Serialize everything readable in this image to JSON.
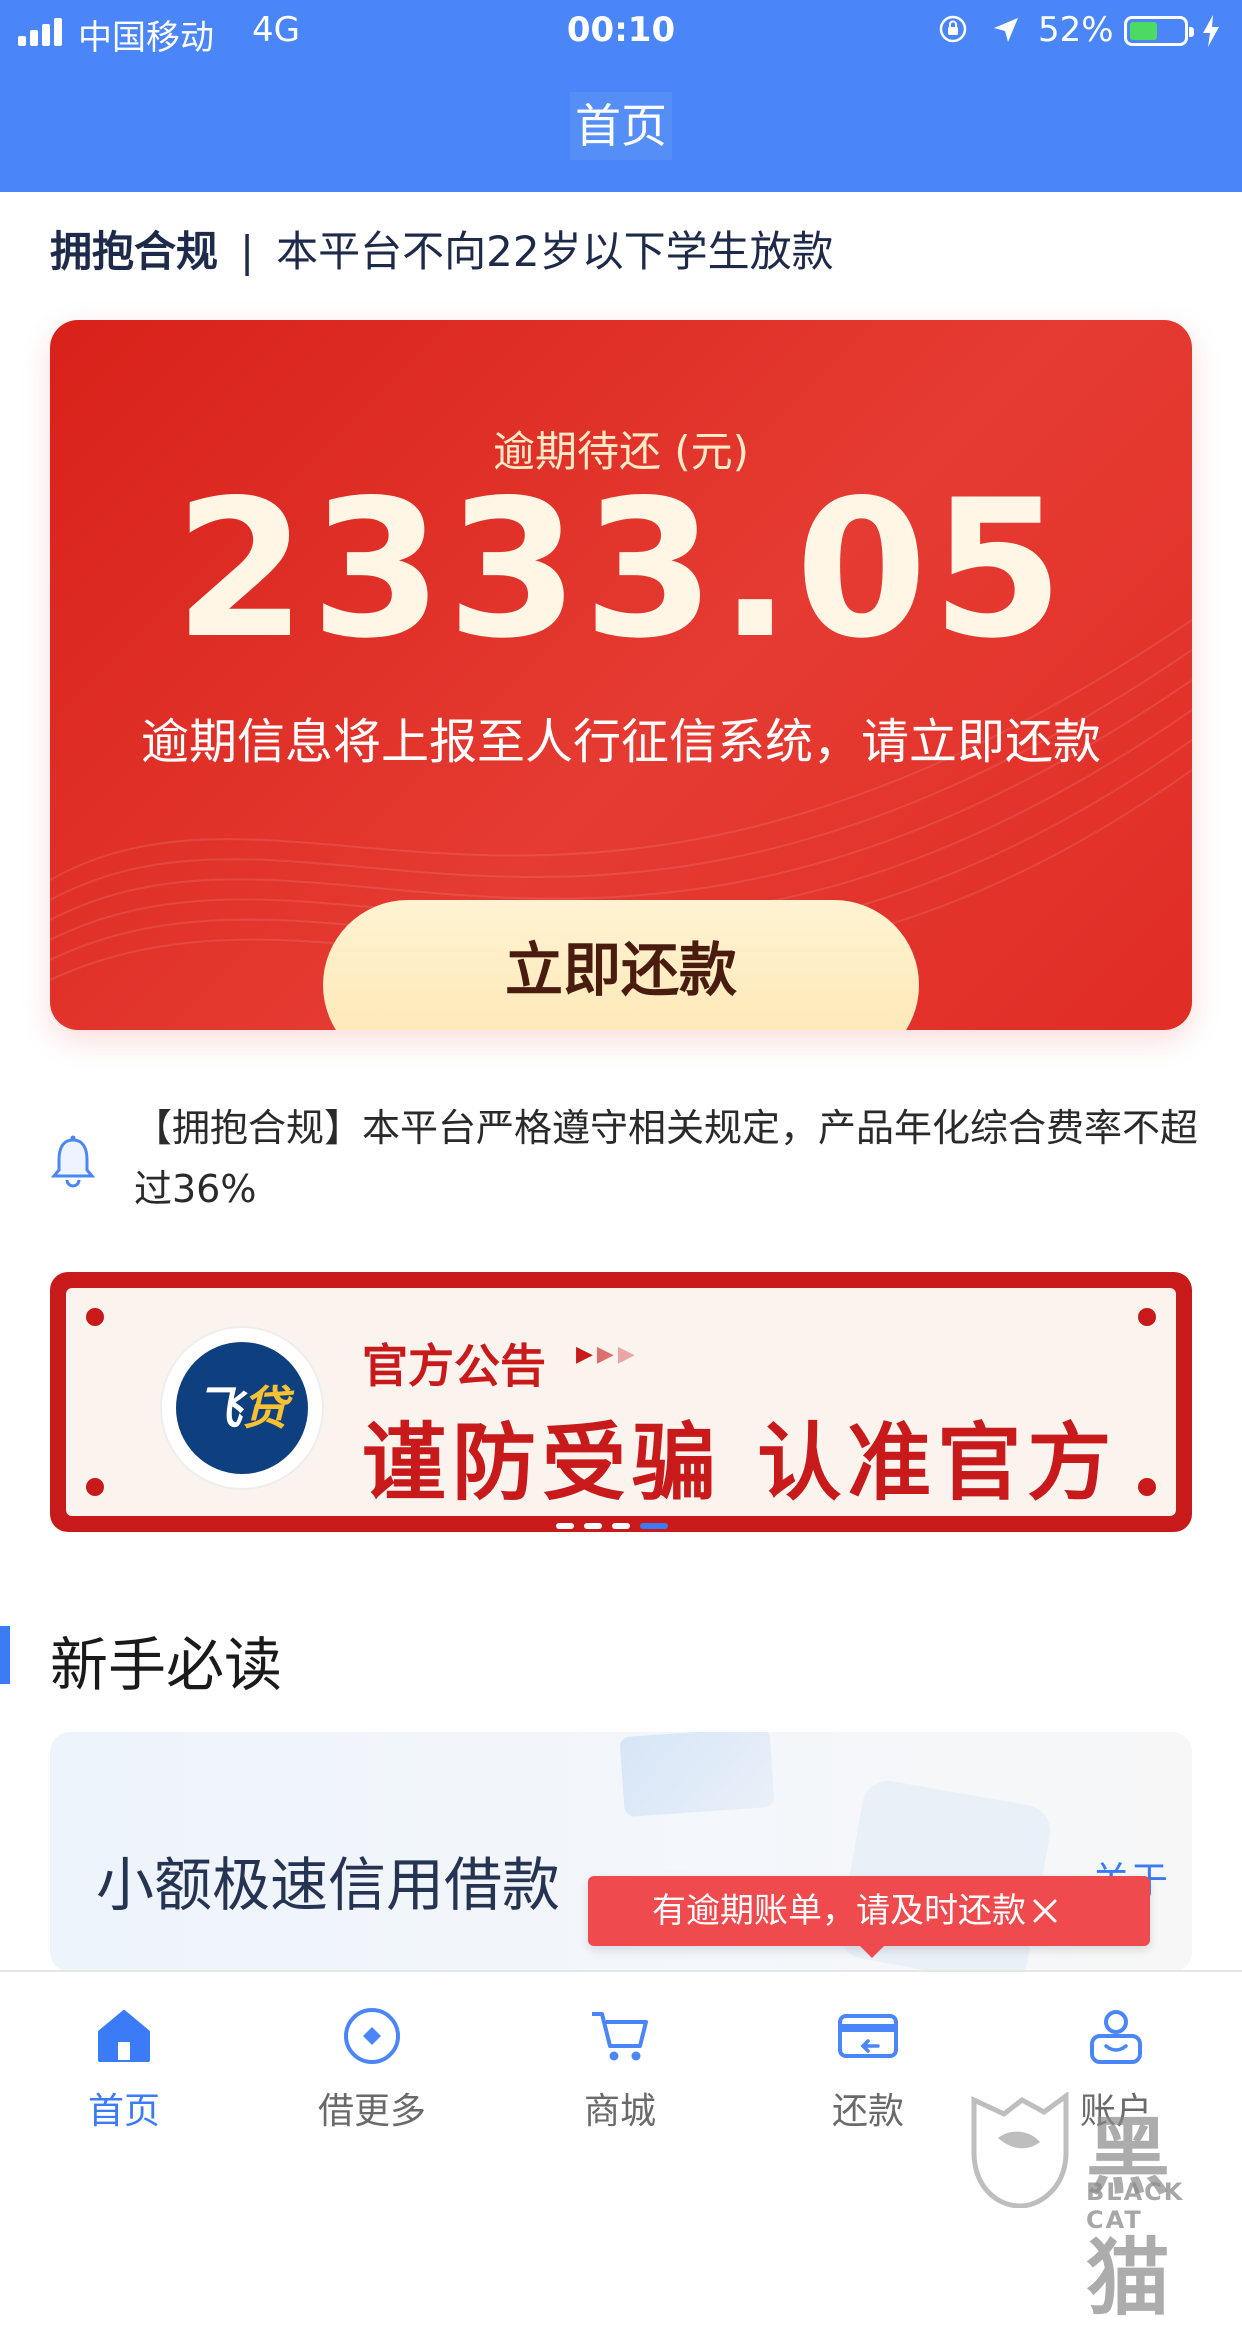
{
  "status_bar": {
    "carrier": "中国移动",
    "network": "4G",
    "time": "00:10",
    "battery_percent": "52%",
    "battery_level": 0.52
  },
  "nav": {
    "title": "首页"
  },
  "compliance": {
    "label": "拥抱合规",
    "separator": "|",
    "text": "本平台不向22岁以下学生放款"
  },
  "overdue_card": {
    "label": "逾期待还 (元)",
    "amount": "2333.05",
    "warning": "逾期信息将上报至人行征信系统，请立即还款",
    "button": "立即还款",
    "colors": {
      "card": "#e0271f",
      "button": "#fdebc0"
    }
  },
  "notice": {
    "icon": "bell-icon",
    "text": "【拥抱合规】本平台严格遵守相关规定，产品年化综合费率不超过36%"
  },
  "banner": {
    "logo_text_1": "飞",
    "logo_text_2": "贷",
    "title": "官方公告",
    "arrows": "▶▶▶",
    "slogan": "谨防受骗 认准官方",
    "page_count": 4,
    "active_page": 3
  },
  "section": {
    "title": "新手必读"
  },
  "guide_card": {
    "title": "小额极速信用借款",
    "more_label": "关于 ›"
  },
  "tooltip": {
    "text": "有逾期账单，请及时还款",
    "close_icon": "close-icon"
  },
  "tabs": [
    {
      "label": "首页",
      "icon": "home-icon",
      "active": true
    },
    {
      "label": "借更多",
      "icon": "borrow-more-icon",
      "active": false
    },
    {
      "label": "商城",
      "icon": "cart-icon",
      "active": false
    },
    {
      "label": "还款",
      "icon": "repay-card-icon",
      "active": false
    },
    {
      "label": "账户",
      "icon": "account-icon",
      "active": false
    }
  ],
  "watermark": {
    "cn": "黑猫",
    "en": "BLACK CAT"
  },
  "colors": {
    "brand_blue": "#4a86f7",
    "accent_blue": "#3b7bf5",
    "alert_red": "#ef4a4e",
    "banner_red": "#c8191b"
  }
}
